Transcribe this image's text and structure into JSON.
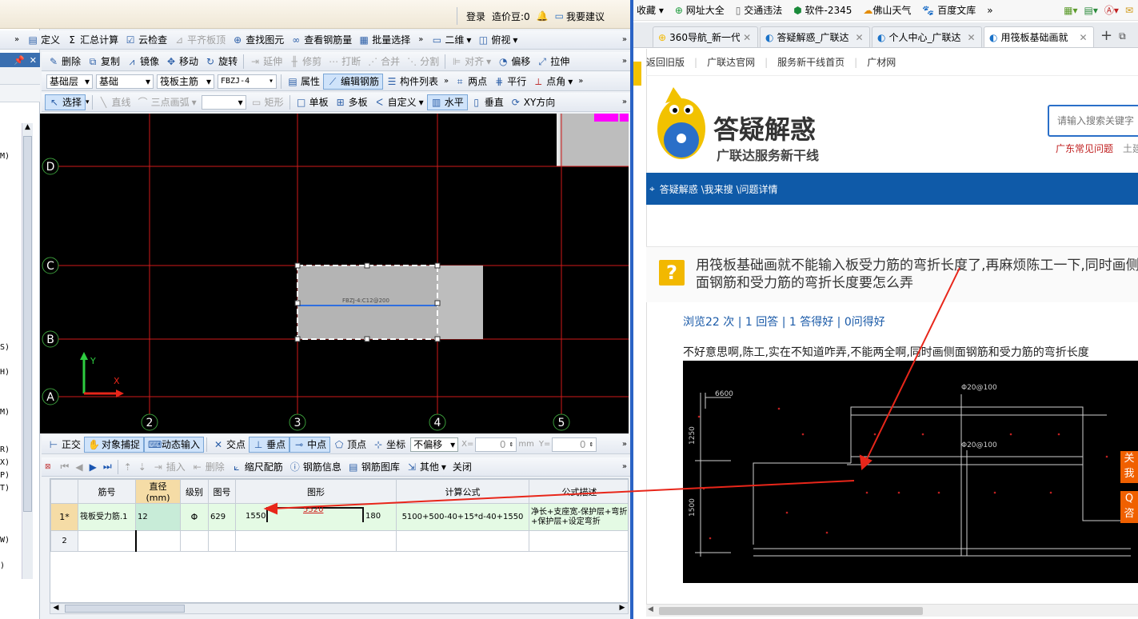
{
  "app": {
    "topbar": {
      "login": "登录",
      "beans": "造价豆:0",
      "suggest": "我要建议"
    },
    "menu": {
      "define": "定义",
      "sum": "汇总计算",
      "cloud": "云检查",
      "level": "平齐板顶",
      "find": "查找图元",
      "view_rebar": "查看钢筋量",
      "batch": "批量选择",
      "view2d": "二维",
      "top_view": "俯视"
    },
    "toolbar1": {
      "delete": "删除",
      "copy": "复制",
      "mirror": "镜像",
      "move": "移动",
      "rotate": "旋转",
      "extend": "延伸",
      "trim": "修剪",
      "break": "打断",
      "merge": "合并",
      "split": "分割",
      "align": "对齐",
      "offset": "偏移",
      "stretch": "拉伸"
    },
    "toolbar2": {
      "layer": "基础层",
      "category": "基础",
      "type": "筏板主筋",
      "code": "FBZJ-4",
      "props": "属性",
      "edit_rebar": "编辑钢筋",
      "list": "构件列表",
      "two_pt": "两点",
      "parallel": "平行",
      "pt_angle": "点角"
    },
    "toolbar3": {
      "select": "选择",
      "line": "直线",
      "arc": "三点画弧",
      "rect": "矩形",
      "single": "单板",
      "multi": "多板",
      "custom": "自定义",
      "horizontal": "水平",
      "vertical": "垂直",
      "xy": "XY方向"
    },
    "cad": {
      "axes_h": [
        "D",
        "C",
        "B",
        "A"
      ],
      "axes_v": [
        "2",
        "3",
        "4",
        "5"
      ],
      "rebar_label": "FBZJ-4:C12@200",
      "y_label": "Y",
      "x_label": "X"
    },
    "snapbar": {
      "ortho": "正交",
      "snap": "对象捕捉",
      "dynamic": "动态输入",
      "intersect": "交点",
      "perp": "垂点",
      "mid": "中点",
      "vertex": "顶点",
      "coord": "坐标",
      "offset": "不偏移",
      "x_label": "X=",
      "x_val": "0",
      "unit": "mm",
      "y_label": "Y=",
      "y_val": "0"
    },
    "gridbar": {
      "insert": "插入",
      "delete": "删除",
      "scale": "缩尺配筋",
      "info": "钢筋信息",
      "lib": "钢筋图库",
      "other": "其他",
      "close": "关闭"
    },
    "table": {
      "headers": [
        "筋号",
        "直径(mm)",
        "级别",
        "图号",
        "图形",
        "计算公式",
        "公式描述"
      ],
      "row1": {
        "idx": "1*",
        "name": "筏板受力筋.1",
        "dia": "12",
        "grade": "Φ",
        "fig": "629",
        "left": "1550",
        "mid": "5520",
        "right": "180",
        "formula": "5100+500-40+15*d-40+1550",
        "desc": "净长+支座宽-保护层+弯折+保护层+设定弯折"
      },
      "row2": {
        "idx": "2"
      }
    },
    "leftpanel": {
      "labels": [
        "M)",
        "S)",
        "H)",
        "M)",
        "R)",
        "X)",
        "P)",
        "T)",
        "W)",
        ")"
      ]
    }
  },
  "browser": {
    "favbar": [
      "收藏",
      "网址大全",
      "交通违法",
      "软件-2345",
      "佛山天气",
      "百度文库"
    ],
    "tabs": [
      "360导航_新一代",
      "答疑解惑_广联达",
      "个人中心_广联达",
      "用筏板基础画就"
    ],
    "sitenav": [
      "返回旧版",
      "广联达官网",
      "服务新干线首页",
      "广材网"
    ],
    "logo_title": "答疑解惑",
    "logo_sub": "广联达服务新干线",
    "search_placeholder": "请输入搜索关键字",
    "hot": [
      "广东常见问题",
      "土建"
    ],
    "breadcrumb": "答疑解惑 \\我来搜 \\问题详情",
    "question": "用筏板基础画就不能输入板受力筋的弯折长度了,再麻烦陈工一下,同时画侧面钢筋和受力筋的弯折长度要怎么弄",
    "stats": "浏览22 次 | 1 回答 | 1 答得好 | 0问得好",
    "body": "不好意思啊,陈工,实在不知道咋弄,不能两全啊,同时画侧面钢筋和受力筋的弯折长度",
    "img": {
      "dim1": "6600",
      "note1": "Φ20@100",
      "note2": "Φ20@100",
      "dim_v1": "1250",
      "dim_v2": "1500"
    },
    "float_btns": [
      "关",
      "我",
      "Q",
      "咨"
    ]
  }
}
